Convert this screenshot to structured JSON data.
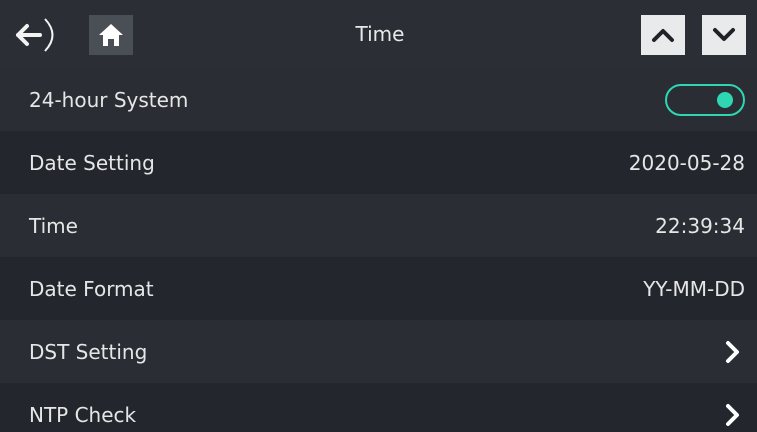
{
  "header": {
    "title": "Time",
    "back_icon": "back-arrow-icon",
    "home_icon": "home-icon",
    "up_icon": "chevron-up-icon",
    "down_icon": "chevron-down-icon"
  },
  "rows": [
    {
      "label": "24-hour System",
      "control": "toggle",
      "toggle_on": true
    },
    {
      "label": "Date Setting",
      "value": "2020-05-28"
    },
    {
      "label": "Time",
      "value": "22:39:34"
    },
    {
      "label": "Date Format",
      "value": "YY-MM-DD"
    },
    {
      "label": "DST Setting",
      "control": "chevron-right-icon"
    },
    {
      "label": "NTP Check",
      "control": "chevron-right-icon"
    }
  ],
  "colors": {
    "background": "#1f2328",
    "header": "#2b2f35",
    "accent": "#2fd6b2",
    "text": "#e6e6e6"
  }
}
